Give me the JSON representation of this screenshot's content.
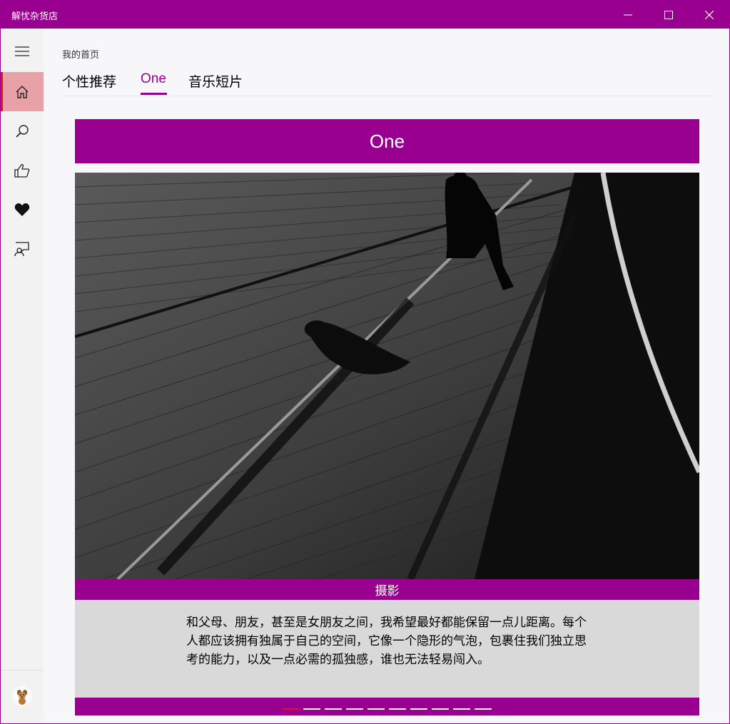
{
  "app": {
    "title": "解忧杂货店"
  },
  "window_controls": {
    "minimize": "minimize-icon",
    "maximize": "maximize-icon",
    "close": "close-icon"
  },
  "sidebar": {
    "items": [
      {
        "icon": "hamburger-menu-icon"
      },
      {
        "icon": "home-icon",
        "active": true
      },
      {
        "icon": "search-icon"
      },
      {
        "icon": "thumbs-up-icon"
      },
      {
        "icon": "heart-icon"
      },
      {
        "icon": "feedback-icon"
      }
    ],
    "avatar": "avatar"
  },
  "main": {
    "page_title": "我的首页",
    "tabs": [
      {
        "label": "个性推荐"
      },
      {
        "label": "One",
        "selected": true
      },
      {
        "label": "音乐短片"
      }
    ]
  },
  "card": {
    "header": "One",
    "caption": "摄影",
    "quote": "和父母、朋友，甚至是女朋友之间，我希望最好都能保留一点儿距离。每个人都应该拥有独属于自己的空间，它像一个隐形的气泡，包裹住我们独立思考的能力，以及一点必需的孤独感，谁也无法轻易闯入。",
    "pager": {
      "total": 10,
      "current": 1
    }
  },
  "colors": {
    "accent": "#990090",
    "active_indicator": "#e81123",
    "sidebar_active": "#e8a1a6"
  }
}
